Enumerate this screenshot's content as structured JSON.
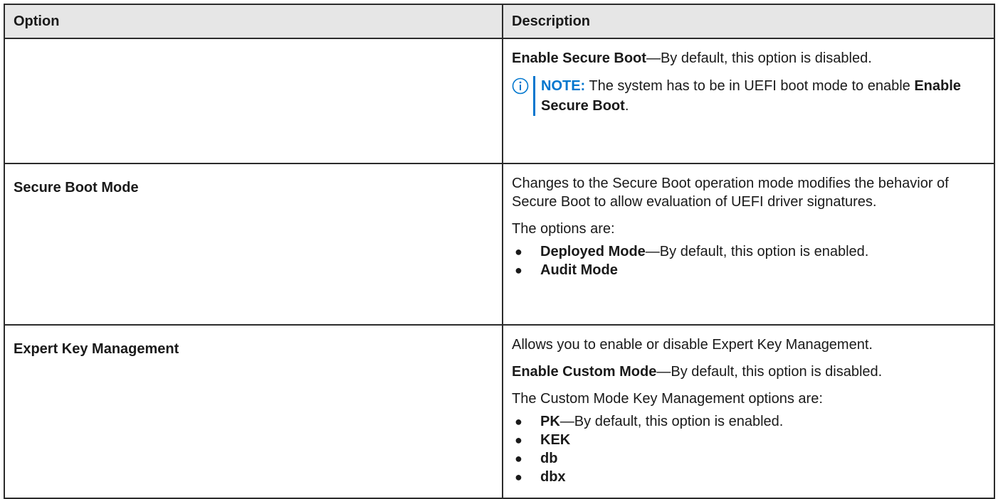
{
  "table": {
    "headers": {
      "option": "Option",
      "description": "Description"
    },
    "rows": [
      {
        "option": "",
        "desc_p1_bold": "Enable Secure Boot",
        "desc_p1_rest": "—By default, this option is disabled.",
        "note_label": "NOTE:",
        "note_text": " The system has to be in UEFI boot mode to enable ",
        "note_bold": "Enable Secure Boot",
        "note_end": "."
      },
      {
        "option": "Secure Boot Mode",
        "desc_p1": "Changes to the Secure Boot operation mode modifies the behavior of Secure Boot to allow evaluation of UEFI driver signatures.",
        "desc_p2": "The options are:",
        "items": [
          {
            "bold": "Deployed Mode",
            "rest": "—By default, this option is enabled."
          },
          {
            "bold": "Audit Mode",
            "rest": ""
          }
        ]
      },
      {
        "option": "Expert Key Management",
        "desc_p1": "Allows you to enable or disable Expert Key Management.",
        "desc_p2_bold": "Enable Custom Mode",
        "desc_p2_rest": "—By default, this option is disabled.",
        "desc_p3": "The Custom Mode Key Management options are:",
        "items": [
          {
            "bold": "PK",
            "rest": "—By default, this option is enabled."
          },
          {
            "bold": "KEK",
            "rest": ""
          },
          {
            "bold": "db",
            "rest": ""
          },
          {
            "bold": "dbx",
            "rest": ""
          }
        ]
      }
    ]
  },
  "icons": {
    "note": "info-circle-icon",
    "bullet": "●"
  },
  "colors": {
    "accent": "#0076ce",
    "header_bg": "#e6e6e6",
    "border": "#2b2b2b"
  }
}
